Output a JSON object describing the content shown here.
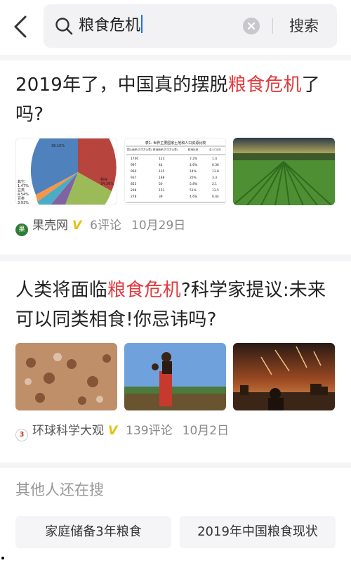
{
  "search": {
    "query": "粮食危机",
    "button_label": "搜索"
  },
  "articles": [
    {
      "title_parts": [
        "2019年了，中国真的摆脱",
        "粮食危机",
        "了吗?"
      ],
      "source": "果壳网",
      "source_icon_text": "果",
      "verified": "V",
      "comments": "6评论",
      "date": "10月29日",
      "images": [
        "pie-chart-thumbnail",
        "land-table-thumbnail",
        "crop-field-thumbnail"
      ],
      "table_image": {
        "caption": "表1: 世界主要国家土地和人口资源比较",
        "headers": [
          "国土面积(万平方公里)",
          "耕地面积(万平方公里)",
          "耕地比例",
          "总人口(亿)"
        ],
        "rows": [
          [
            "1700",
            "123",
            "7.2%",
            "1.4"
          ],
          [
            "997",
            "44",
            "4.6%",
            "0.36"
          ],
          [
            "960",
            "135",
            "14%",
            "13.8"
          ],
          [
            "937",
            "188",
            "20%",
            "3.3"
          ],
          [
            "855",
            "50",
            "5.8%",
            "2.1"
          ],
          [
            "298",
            "153",
            "51%",
            "13.5"
          ],
          [
            "278",
            "39",
            "4.6%",
            "0.44"
          ]
        ]
      },
      "pie_image": {
        "labels": [
          "其它",
          "1.47%",
          "豆类",
          "4.54%",
          "豆类",
          "3.93%",
          "稻谷",
          "38.10%",
          "34.36%"
        ]
      }
    },
    {
      "title_parts": [
        "人类将面临",
        "粮食危机",
        "?科学家提议:未来可以同类相食!你忌讳吗?"
      ],
      "source": "环球科学大观",
      "source_icon_text": "3",
      "verified": "V",
      "comments": "139评论",
      "date": "10月2日",
      "images": [
        "cave-hands-thumbnail",
        "woman-carrying-thumbnail",
        "apocalypse-city-thumbnail"
      ]
    }
  ],
  "others": {
    "title": "其他人还在搜",
    "chips": [
      "家庭储备3年粮食",
      "2019年中国粮食现状"
    ]
  },
  "colors": {
    "highlight": "#e0393e",
    "verified": "#e6c010",
    "background_gap": "#f5f5f7"
  }
}
